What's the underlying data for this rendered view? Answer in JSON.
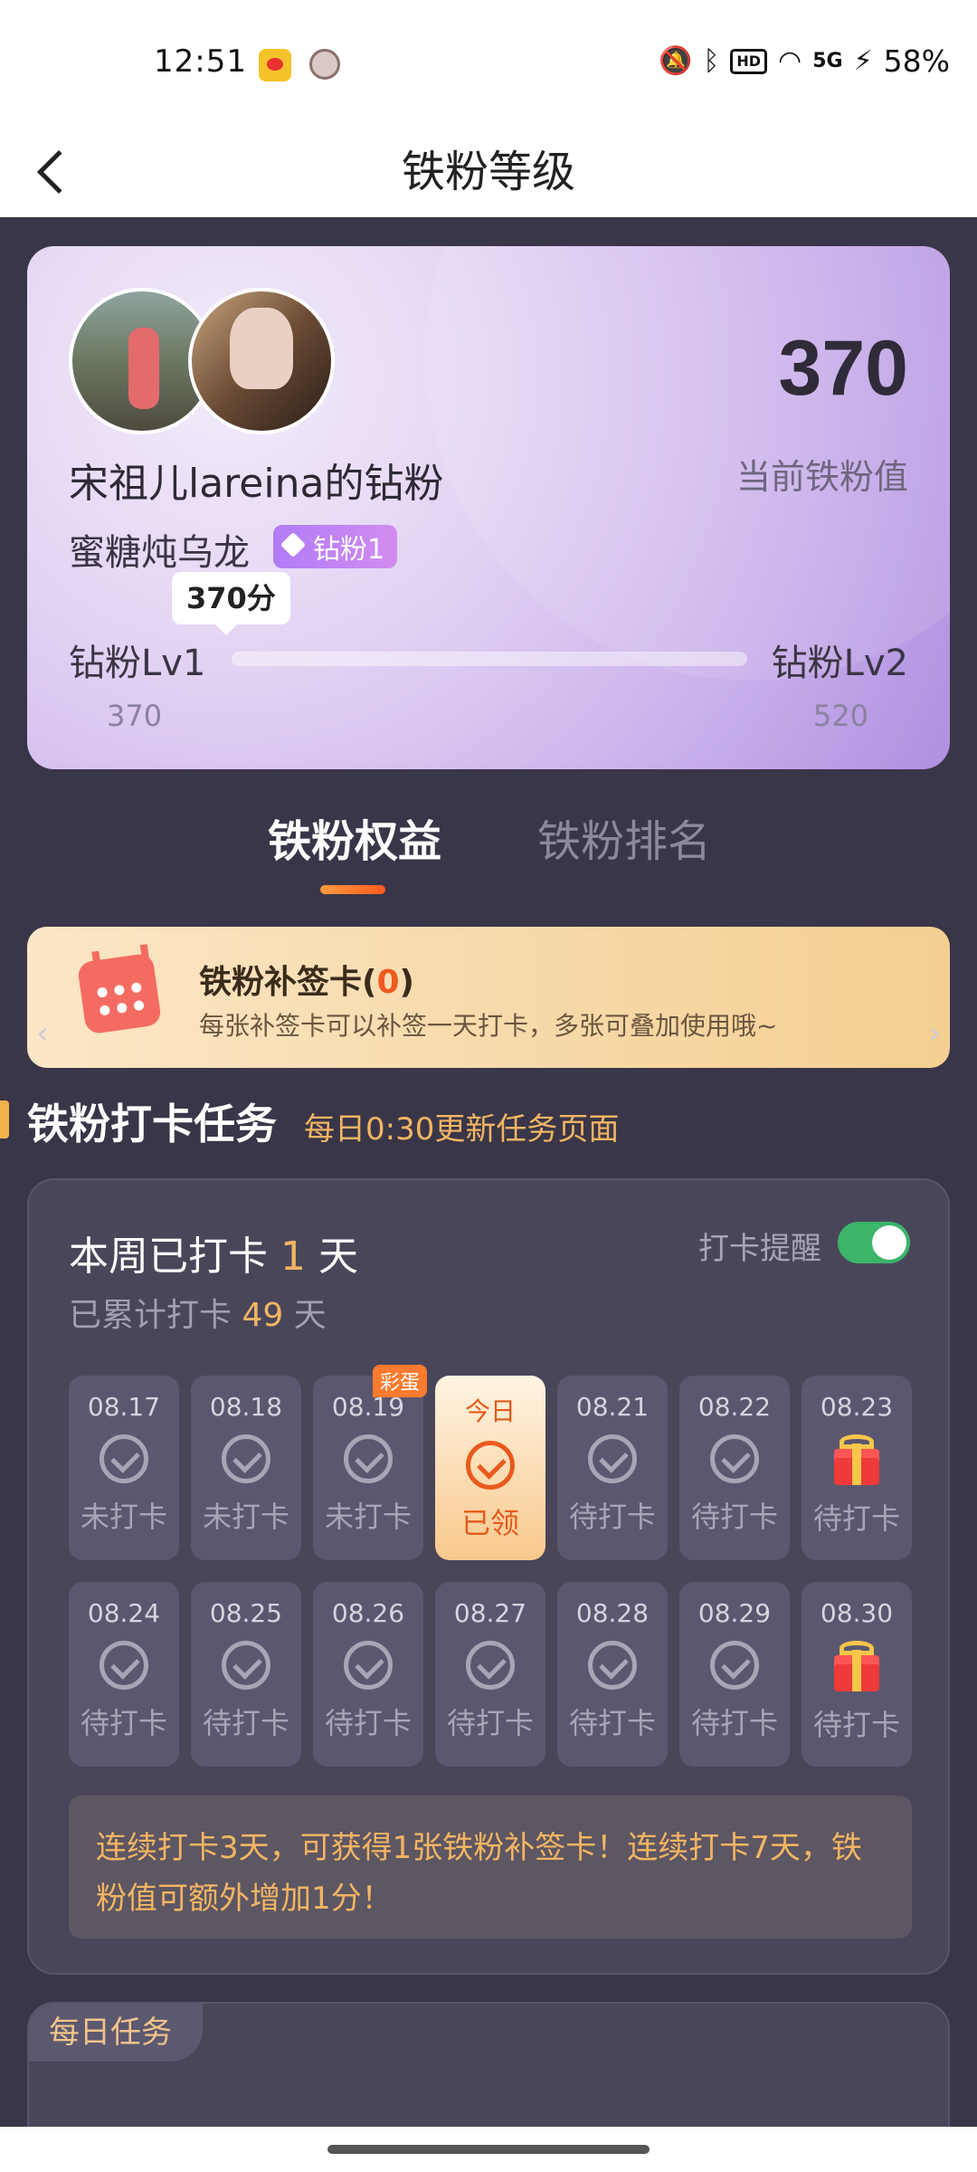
{
  "status_bar": {
    "time": "12:51",
    "battery": "58%",
    "network": "5G",
    "hd": "HD",
    "icons": [
      "weibo-app-icon",
      "avatar-notification-icon",
      "mute-icon",
      "bluetooth-icon",
      "wifi-icon",
      "signal-icon",
      "charging-icon"
    ]
  },
  "header": {
    "title": "铁粉等级"
  },
  "profile": {
    "fan_name": "宋祖儿lareina的钻粉",
    "nickname": "蜜糖炖乌龙",
    "badge": "钻粉1",
    "score": "370",
    "score_label": "当前铁粉值",
    "tooltip": "370分",
    "level_left": "钻粉Lv1",
    "level_right": "钻粉Lv2",
    "level_left_value": "370",
    "level_right_value": "520",
    "progress": 0.0
  },
  "tabs": [
    "铁粉权益",
    "铁粉排名"
  ],
  "makeup_card": {
    "title": "铁粉补签卡(",
    "count": "0",
    "title_end": ")",
    "desc": "每张补签卡可以补签一天打卡，多张可叠加使用哦~"
  },
  "section": {
    "title": "铁粉打卡任务",
    "subtitle": "每日0:30更新任务页面"
  },
  "checkin": {
    "week_prefix": "本周已打卡",
    "week_count": "1",
    "week_suffix": "天",
    "total_prefix": "已累计打卡",
    "total_count": "49",
    "total_suffix": "天",
    "remind_label": "打卡提醒",
    "remind_on": true,
    "egg_badge": "彩蛋",
    "days": [
      {
        "date": "08.17",
        "status": "未打卡",
        "icon": "check-icon"
      },
      {
        "date": "08.18",
        "status": "未打卡",
        "icon": "check-icon"
      },
      {
        "date": "08.19",
        "status": "未打卡",
        "icon": "check-icon"
      },
      {
        "date": "今日",
        "status": "已领",
        "icon": "check-icon"
      },
      {
        "date": "08.21",
        "status": "待打卡",
        "icon": "check-icon"
      },
      {
        "date": "08.22",
        "status": "待打卡",
        "icon": "check-icon"
      },
      {
        "date": "08.23",
        "status": "待打卡",
        "icon": "gift-icon"
      },
      {
        "date": "08.24",
        "status": "待打卡",
        "icon": "check-icon"
      },
      {
        "date": "08.25",
        "status": "待打卡",
        "icon": "check-icon"
      },
      {
        "date": "08.26",
        "status": "待打卡",
        "icon": "check-icon"
      },
      {
        "date": "08.27",
        "status": "待打卡",
        "icon": "check-icon"
      },
      {
        "date": "08.28",
        "status": "待打卡",
        "icon": "check-icon"
      },
      {
        "date": "08.29",
        "status": "待打卡",
        "icon": "check-icon"
      },
      {
        "date": "08.30",
        "status": "待打卡",
        "icon": "gift-icon"
      }
    ],
    "tip": "连续打卡3天，可获得1张铁粉补签卡！连续打卡7天，铁粉值可额外增加1分！"
  },
  "daily_tasks": {
    "tag": "每日任务"
  },
  "colors": {
    "accent": "#f3b562",
    "orange": "#ea5a1c",
    "background": "#3a3649",
    "toggle": "#3cb46a"
  }
}
